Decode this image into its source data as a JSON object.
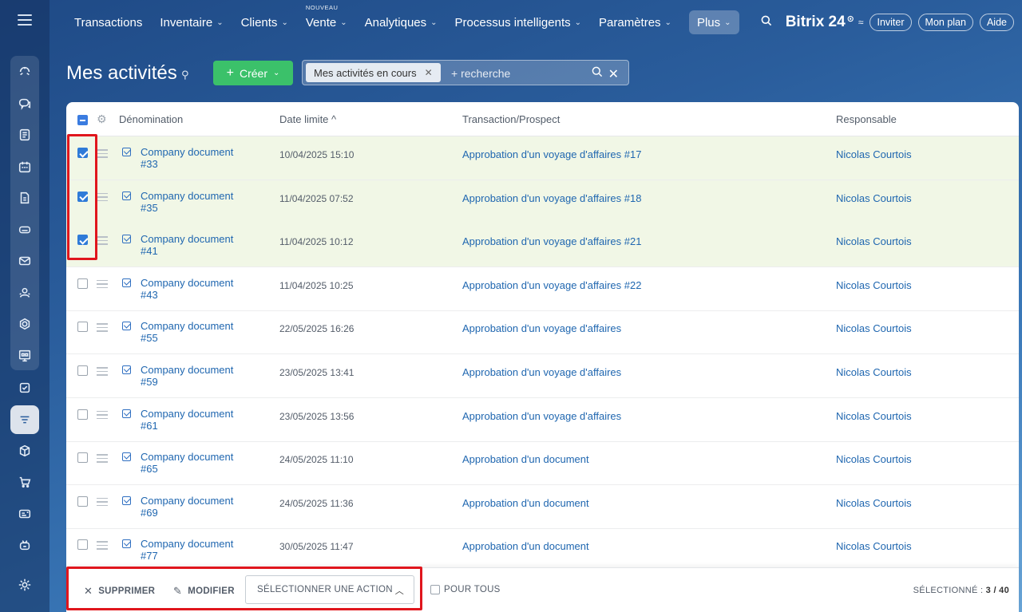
{
  "nav": {
    "items": [
      {
        "label": "Transactions",
        "chevron": false
      },
      {
        "label": "Inventaire",
        "chevron": true
      },
      {
        "label": "Clients",
        "chevron": true
      },
      {
        "label": "Vente",
        "chevron": true,
        "badge": "NOUVEAU"
      },
      {
        "label": "Analytiques",
        "chevron": true
      },
      {
        "label": "Processus intelligents",
        "chevron": true
      },
      {
        "label": "Paramètres",
        "chevron": true
      },
      {
        "label": "Plus",
        "chevron": true
      }
    ],
    "brand": "Bitrix 24",
    "invite": "Inviter",
    "plan": "Mon plan",
    "help": "Aide"
  },
  "sidebar": {
    "icons": [
      "feed-icon",
      "chat-icon",
      "tasks-icon",
      "calendar-icon",
      "document-icon",
      "drive-icon",
      "mail-icon",
      "contacts-icon",
      "sites-icon",
      "board-icon",
      "checklist-icon",
      "crm-icon",
      "inventory-icon",
      "shop-icon",
      "cards-icon",
      "bot-icon",
      "settings-icon"
    ],
    "active": "crm-icon"
  },
  "header": {
    "title": "Mes activités",
    "create_label": "Créer",
    "filter_tag": "Mes activités en cours",
    "search_placeholder": "+ recherche"
  },
  "table": {
    "columns": {
      "name": "Dénomination",
      "deadline": "Date limite ^",
      "deal": "Transaction/Prospect",
      "responsible": "Responsable"
    },
    "rows": [
      {
        "name": "Company document #33",
        "date": "10/04/2025 15:10",
        "deal": "Approbation d'un voyage d'affaires #17",
        "responsible": "Nicolas Courtois",
        "checked": true
      },
      {
        "name": "Company document #35",
        "date": "11/04/2025 07:52",
        "deal": "Approbation d'un voyage d'affaires #18",
        "responsible": "Nicolas Courtois",
        "checked": true
      },
      {
        "name": "Company document #41",
        "date": "11/04/2025 10:12",
        "deal": "Approbation d'un voyage d'affaires #21",
        "responsible": "Nicolas Courtois",
        "checked": true
      },
      {
        "name": "Company document #43",
        "date": "11/04/2025 10:25",
        "deal": "Approbation d'un voyage d'affaires #22",
        "responsible": "Nicolas Courtois",
        "checked": false
      },
      {
        "name": "Company document #55",
        "date": "22/05/2025 16:26",
        "deal": "Approbation d'un voyage d'affaires",
        "responsible": "Nicolas Courtois",
        "checked": false
      },
      {
        "name": "Company document #59",
        "date": "23/05/2025 13:41",
        "deal": "Approbation d'un voyage d'affaires",
        "responsible": "Nicolas Courtois",
        "checked": false
      },
      {
        "name": "Company document #61",
        "date": "23/05/2025 13:56",
        "deal": "Approbation d'un voyage d'affaires",
        "responsible": "Nicolas Courtois",
        "checked": false
      },
      {
        "name": "Company document #65",
        "date": "24/05/2025 11:10",
        "deal": "Approbation d'un document",
        "responsible": "Nicolas Courtois",
        "checked": false
      },
      {
        "name": "Company document #69",
        "date": "24/05/2025 11:36",
        "deal": "Approbation d'un document",
        "responsible": "Nicolas Courtois",
        "checked": false
      },
      {
        "name": "Company document #77",
        "date": "30/05/2025 11:47",
        "deal": "Approbation d'un document",
        "responsible": "Nicolas Courtois",
        "checked": false
      }
    ]
  },
  "actions": {
    "delete": "SUPPRIMER",
    "edit": "MODIFIER",
    "select_action": "SÉLECTIONNER UNE ACTION",
    "for_all": "POUR TOUS",
    "selected_label": "SÉLECTIONNÉ :",
    "selected_count": "3 / 40"
  },
  "colors": {
    "accent": "#2f7bd8",
    "create": "#3bc16a",
    "selected_row": "#f1f7e6",
    "highlight": "#e0161d",
    "link": "#2067b0"
  }
}
